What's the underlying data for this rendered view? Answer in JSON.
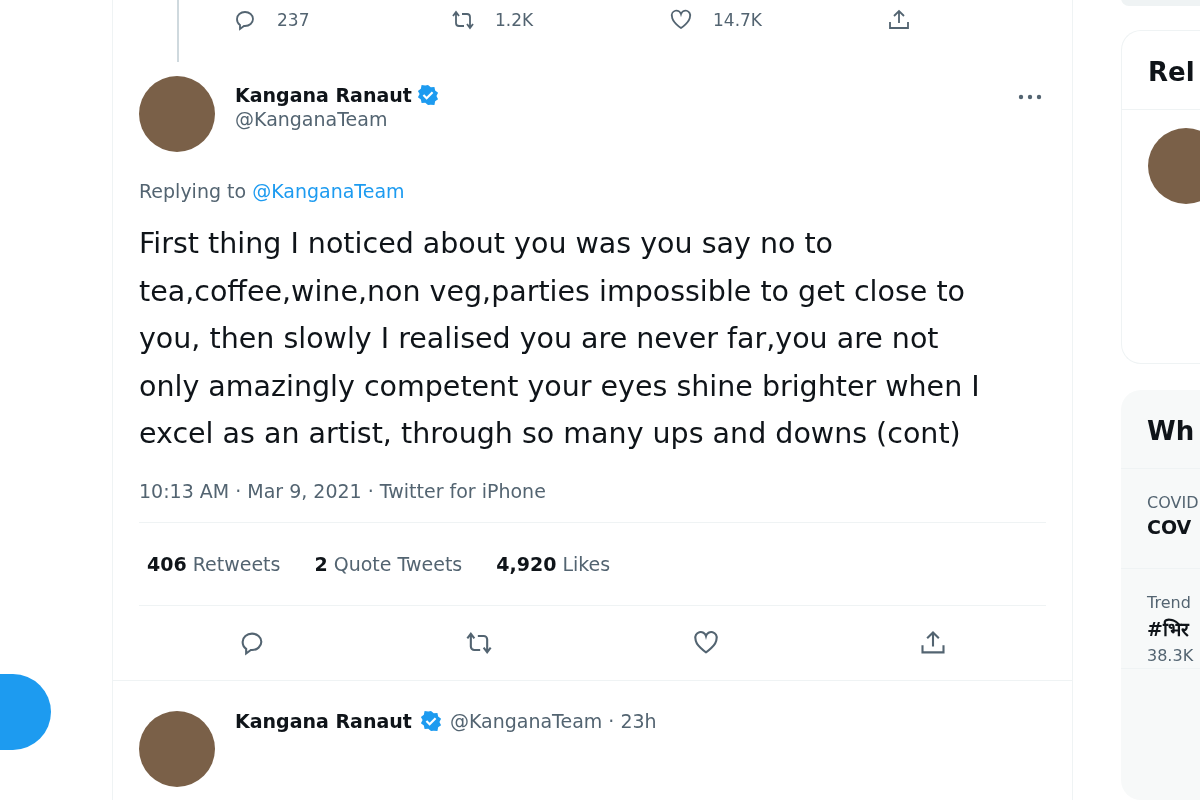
{
  "previous_tweet_actions": [
    {
      "kind": "reply",
      "count": "237"
    },
    {
      "kind": "retweet",
      "count": "1.2K"
    },
    {
      "kind": "like",
      "count": "14.7K"
    },
    {
      "kind": "share"
    }
  ],
  "tweet": {
    "author": {
      "name": "Kangana Ranaut",
      "verified": true,
      "handle": "@KanganaTeam"
    },
    "replying_to": {
      "label": "Replying to",
      "handle": "@KanganaTeam"
    },
    "text": "First thing I noticed about you was you say no to tea,coffee,wine,non veg,parties impossible to get close to you, then slowly I realised you are never far,you are not only amazingly competent your eyes shine brighter when I excel as an artist, through so many ups and downs (cont)",
    "timestamp": "10:13 AM · Mar 9, 2021 · Twitter for iPhone",
    "stats": [
      {
        "count": "406",
        "label": "Retweets"
      },
      {
        "count": "2",
        "label": "Quote Tweets"
      },
      {
        "count": "4,920",
        "label": "Likes"
      }
    ],
    "actions": [
      {
        "kind": "reply"
      },
      {
        "kind": "retweet"
      },
      {
        "kind": "like"
      },
      {
        "kind": "share"
      }
    ]
  },
  "next_tweet": {
    "name": "Kangana Ranaut",
    "verified": true,
    "handle_and_time": "@KanganaTeam · 23h"
  },
  "sidebar": {
    "relevant_people": {
      "title": "Rel"
    },
    "whats_happening": {
      "title": "Wh",
      "trends": [
        {
          "context": "COVID",
          "name": "COV"
        },
        {
          "context": "Trend",
          "name": "#भिर",
          "count": "38.3K"
        }
      ]
    }
  }
}
